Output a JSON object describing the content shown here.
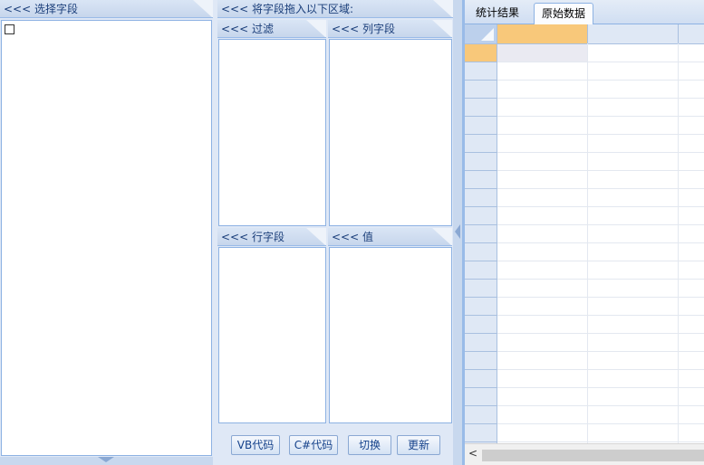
{
  "left_panel": {
    "header": "<<< 选择字段"
  },
  "middle_panel": {
    "header": "<<< 将字段拖入以下区域:",
    "filter": "<<< 过滤",
    "columns": "<<< 列字段",
    "rows": "<<< 行字段",
    "values": "<<< 值"
  },
  "buttons": {
    "vb": "VB代码",
    "cs": "C#代码",
    "toggle": "切换",
    "update": "更新"
  },
  "tabs": {
    "stats": "统计结果",
    "raw": "原始数据"
  },
  "scroll": {
    "left_arrow": "<"
  }
}
